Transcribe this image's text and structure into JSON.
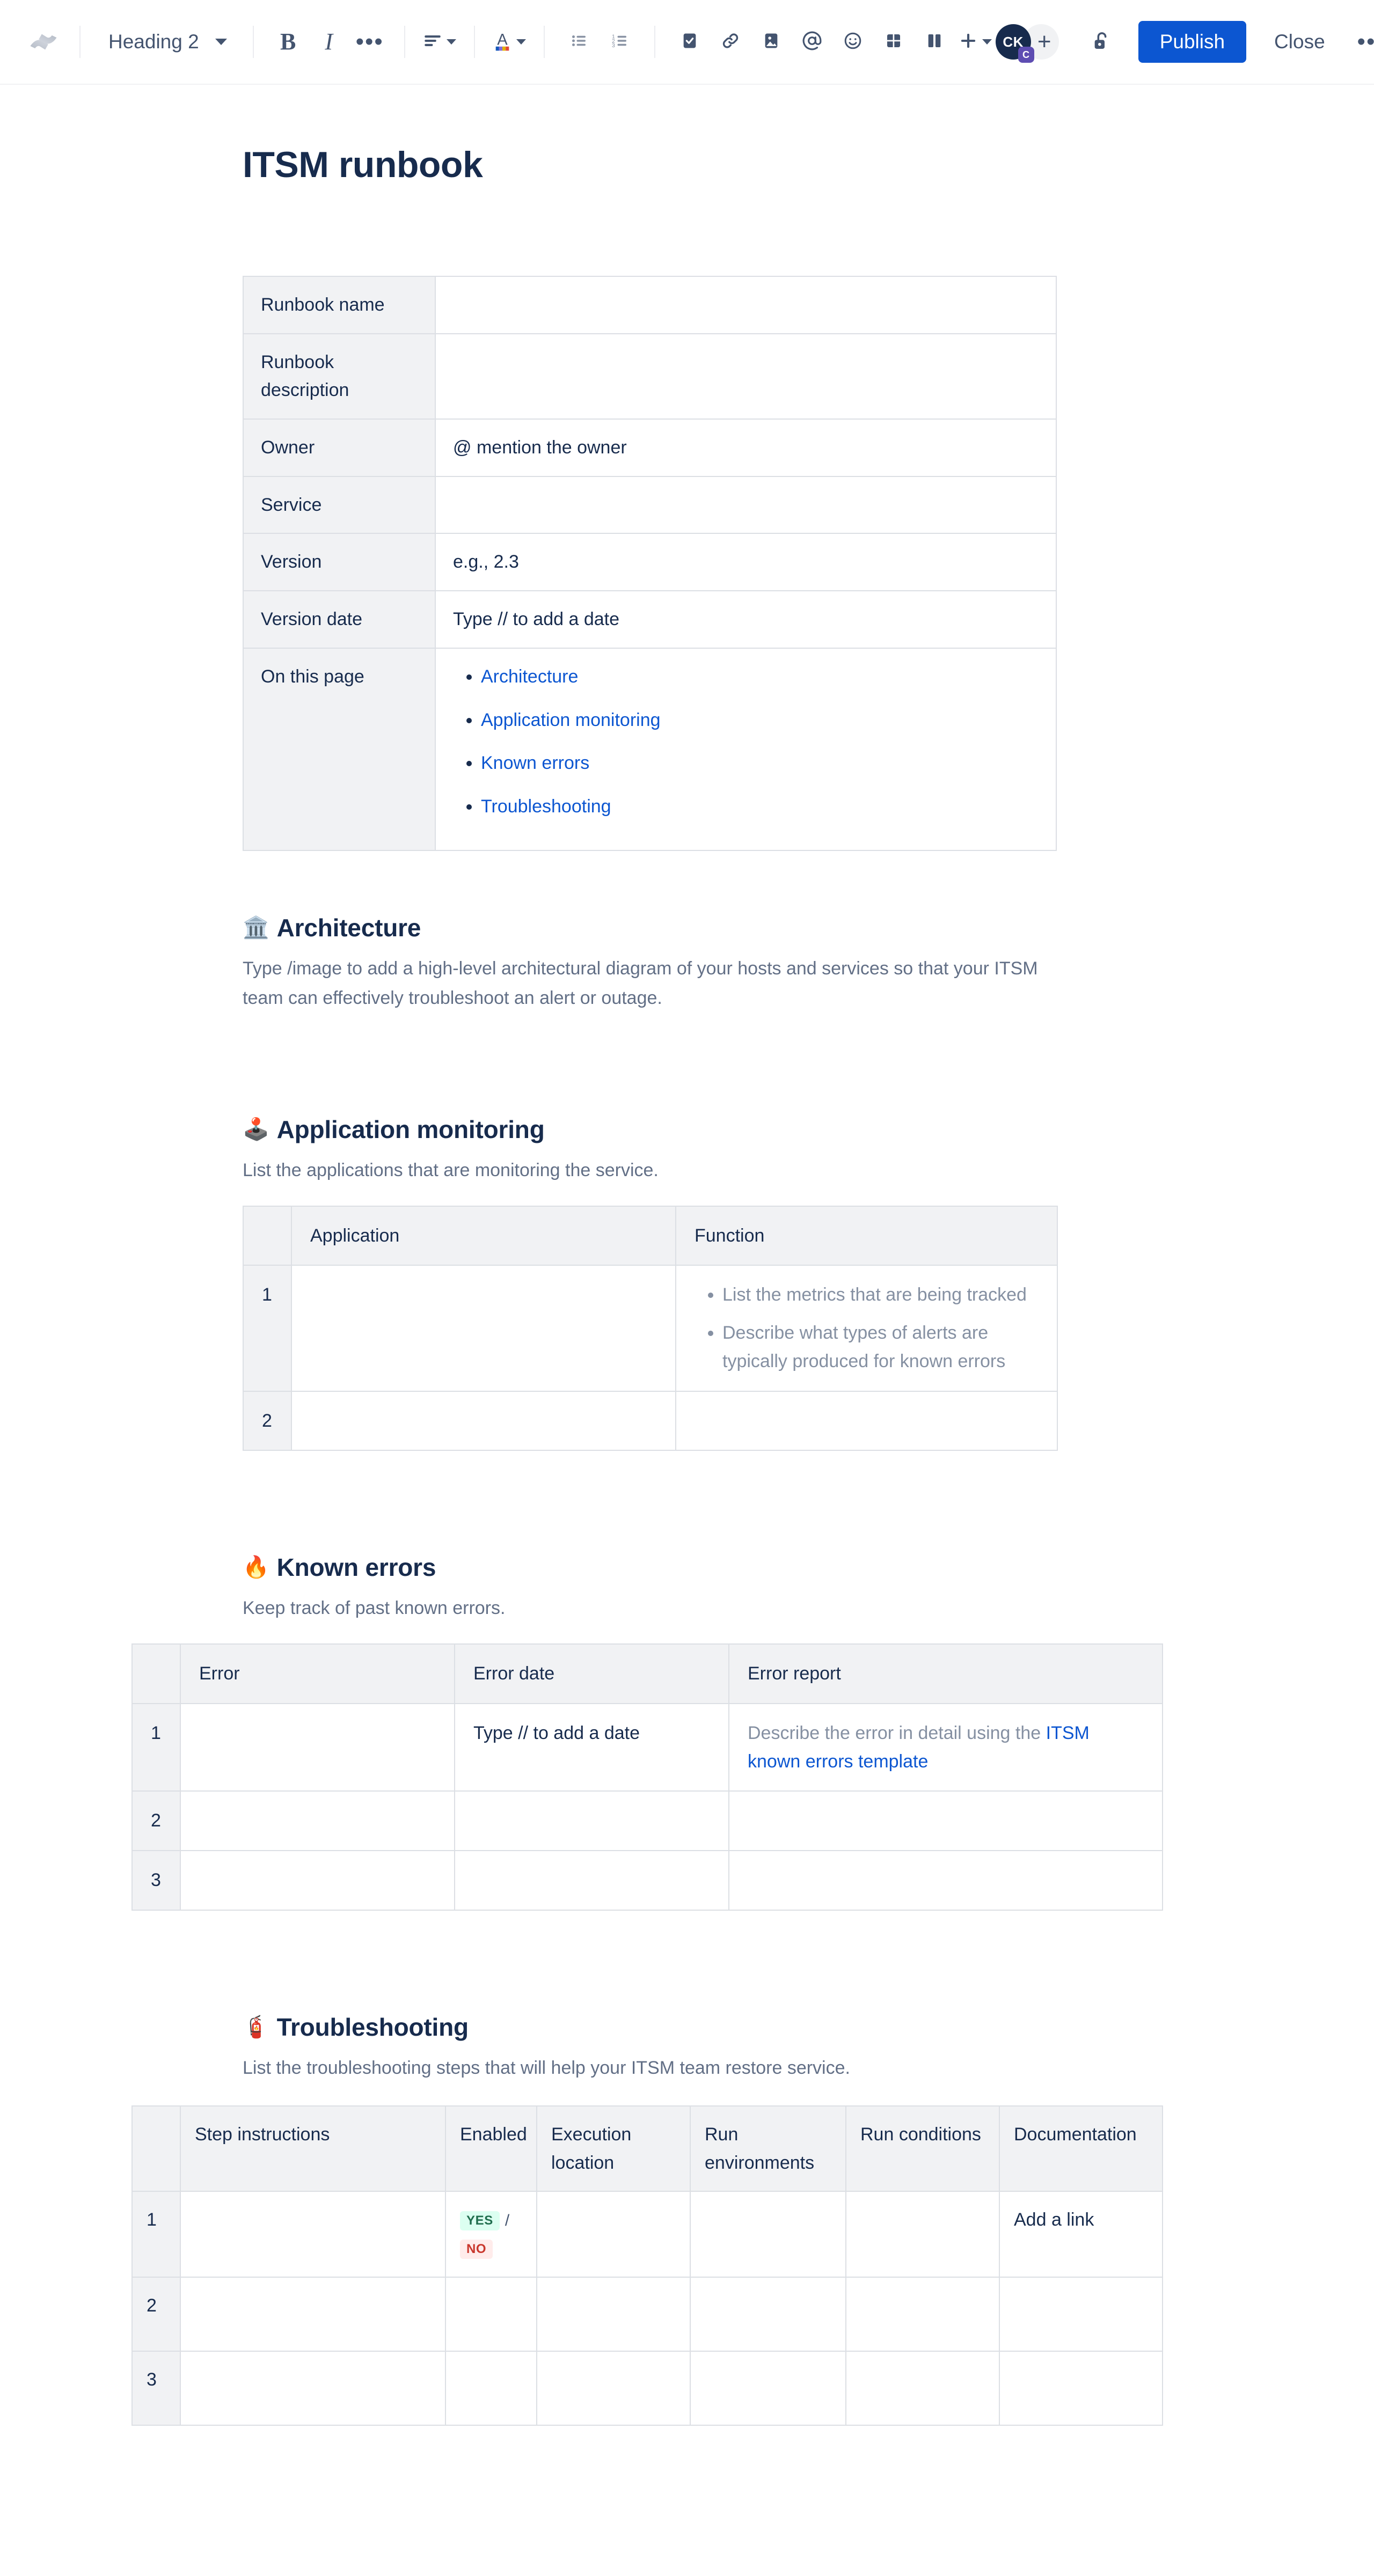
{
  "toolbar": {
    "logo_icon": "confluence-logo-icon",
    "block_type": "Heading 2",
    "bold_label": "B",
    "italic_label": "I",
    "more_formatting_label": "•••",
    "icons": {
      "align": "text-align-icon",
      "text_color": "text-color-icon",
      "bullet_list": "bullet-list-icon",
      "numbered_list": "numbered-list-icon",
      "task": "task-checkbox-icon",
      "link": "link-icon",
      "image": "image-icon",
      "mention": "mention-at-icon",
      "emoji": "emoji-smiley-icon",
      "table": "table-icon",
      "layout": "layout-columns-icon",
      "insert": "plus-insert-icon",
      "lock": "unlocked-padlock-icon",
      "more": "more-options-icon"
    },
    "avatar_initials": "CK",
    "avatar_badge": "C",
    "add_people_label": "+",
    "publish_label": "Publish",
    "close_label": "Close",
    "more_label": "•••"
  },
  "document": {
    "title": "ITSM runbook"
  },
  "meta_table": {
    "rows": [
      {
        "label": "Runbook name",
        "value": "",
        "placeholder": true
      },
      {
        "label": "Runbook description",
        "value": "",
        "placeholder": true
      },
      {
        "label": "Owner",
        "value": "@ mention the owner",
        "placeholder": true
      },
      {
        "label": "Service",
        "value": "",
        "placeholder": true
      },
      {
        "label": "Version",
        "value": "e.g., 2.3",
        "placeholder": true
      },
      {
        "label": "Version date",
        "value": "Type // to add a date",
        "placeholder": true
      }
    ],
    "on_this_page_label": "On this page",
    "on_this_page_links": [
      "Architecture",
      "Application monitoring",
      "Known errors",
      "Troubleshooting"
    ]
  },
  "sections": {
    "architecture": {
      "emoji": "🏛️",
      "emoji_name": "classical-building-emoji",
      "title": "Architecture",
      "description": "Type /image to add a high-level architectural diagram of your hosts and services so that your ITSM team can effectively troubleshoot an alert or outage."
    },
    "application_monitoring": {
      "emoji": "🕹️",
      "emoji_name": "joystick-emoji",
      "title": "Application monitoring",
      "description": "List the applications that are monitoring the service.",
      "table": {
        "headers": [
          "Application",
          "Function"
        ],
        "rows": [
          {
            "num": "1",
            "application": "",
            "function_items": [
              "List the metrics that are being tracked",
              "Describe what types of alerts are typically produced for known errors"
            ]
          },
          {
            "num": "2",
            "application": "",
            "function_items": []
          }
        ]
      }
    },
    "known_errors": {
      "emoji": "🔥",
      "emoji_name": "fire-emoji",
      "title": "Known errors",
      "description": "Keep track of past known errors.",
      "table": {
        "headers": [
          "Error",
          "Error date",
          "Error report"
        ],
        "rows": [
          {
            "num": "1",
            "error": "",
            "error_date": "Type // to add a date",
            "error_report_prefix": "Describe the error in detail using the ",
            "error_report_link": "ITSM known errors template"
          },
          {
            "num": "2",
            "error": "",
            "error_date": "",
            "error_report_prefix": "",
            "error_report_link": ""
          },
          {
            "num": "3",
            "error": "",
            "error_date": "",
            "error_report_prefix": "",
            "error_report_link": ""
          }
        ]
      }
    },
    "troubleshooting": {
      "emoji": "🧯",
      "emoji_name": "fire-extinguisher-emoji",
      "title": "Troubleshooting",
      "description": "List the troubleshooting steps that will help your ITSM team restore service.",
      "table": {
        "headers": [
          "Step instructions",
          "Enabled",
          "Execution location",
          "Run environments",
          "Run conditions",
          "Documentation"
        ],
        "rows": [
          {
            "num": "1",
            "step": "",
            "enabled_yes": "YES",
            "enabled_sep": "/",
            "enabled_no": "NO",
            "execution_location": "",
            "run_environments": "",
            "run_conditions": "",
            "documentation": "Add a link"
          },
          {
            "num": "2",
            "step": "",
            "execution_location": "",
            "run_environments": "",
            "run_conditions": "",
            "documentation": ""
          },
          {
            "num": "3",
            "step": "",
            "execution_location": "",
            "run_environments": "",
            "run_conditions": "",
            "documentation": ""
          }
        ]
      }
    }
  },
  "colors": {
    "primary": "#0C56D1",
    "text": "#172B4D",
    "subtle_text": "#626F86",
    "placeholder": "#8590A2",
    "border": "#DCDFE4",
    "header_bg": "#F1F2F4",
    "badge_purple": "#5E4DB2",
    "success_text": "#216E4E",
    "success_bg": "#DCFFF1",
    "danger_text": "#C9372C",
    "danger_bg": "#FFECEB"
  }
}
